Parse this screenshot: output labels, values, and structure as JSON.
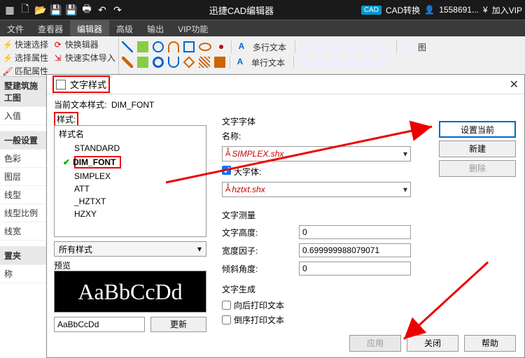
{
  "titlebar": {
    "app_name": "迅捷CAD编辑器",
    "cad_badge": "CAD",
    "convert": "CAD转换",
    "user": "1558691...",
    "vip": "加入VIP"
  },
  "menubar": {
    "file": "文件",
    "viewer": "查看器",
    "editor": "编辑器",
    "advanced": "高级",
    "output": "输出",
    "vip_func": "VIP功能"
  },
  "ribbon_left": {
    "quick_select": "快速选择",
    "quick_editor": "快换辑器",
    "sel_property": "选择属性",
    "import_entity": "快速实体导入",
    "match_property": "匹配属性"
  },
  "ribbon_right": {
    "multiline_text": "多行文本",
    "singleline_text": "单行文本",
    "drawing": "图"
  },
  "left_panel": {
    "header1": "墅建筑施工图",
    "values": "入值",
    "general": "一般设置",
    "color": "色彩",
    "layer": "图层",
    "linetype": "线型",
    "linescale": "线型比例",
    "lineweight": "线宽",
    "header2": "置夹",
    "name": "称"
  },
  "dialog": {
    "title": "文字样式",
    "current_style_label": "当前文本样式:",
    "current_style_value": "DIM_FONT",
    "styles_label": "样式:",
    "list_header": "样式名",
    "styles": [
      "STANDARD",
      "DIM_FONT",
      "SIMPLEX",
      "ATT",
      "_HZTXT",
      "HZXY"
    ],
    "selected_index": 1,
    "all_styles": "所有样式",
    "preview_label": "预览",
    "preview_text": "AaBbCcDd",
    "preview_input": "AaBbCcDd",
    "update_btn": "更新",
    "font": {
      "section": "文字字体",
      "name_label": "名称:",
      "name_value": "SIMPLEX.shx",
      "bigfont_label": "大字体:",
      "bigfont_checked": true,
      "bigfont_value": "hztxt.shx"
    },
    "measure": {
      "section": "文字测量",
      "height_label": "文字高度:",
      "height_value": "0",
      "width_label": "宽度因子:",
      "width_value": "0.699999988079071",
      "oblique_label": "倾斜角度:",
      "oblique_value": "0"
    },
    "gen": {
      "section": "文字生成",
      "backward": "向后打印文本",
      "upside": "倒序打印文本"
    },
    "buttons": {
      "set_current": "设置当前",
      "new": "新建",
      "delete": "删除",
      "apply": "应用",
      "close": "关闭",
      "help": "帮助"
    }
  }
}
